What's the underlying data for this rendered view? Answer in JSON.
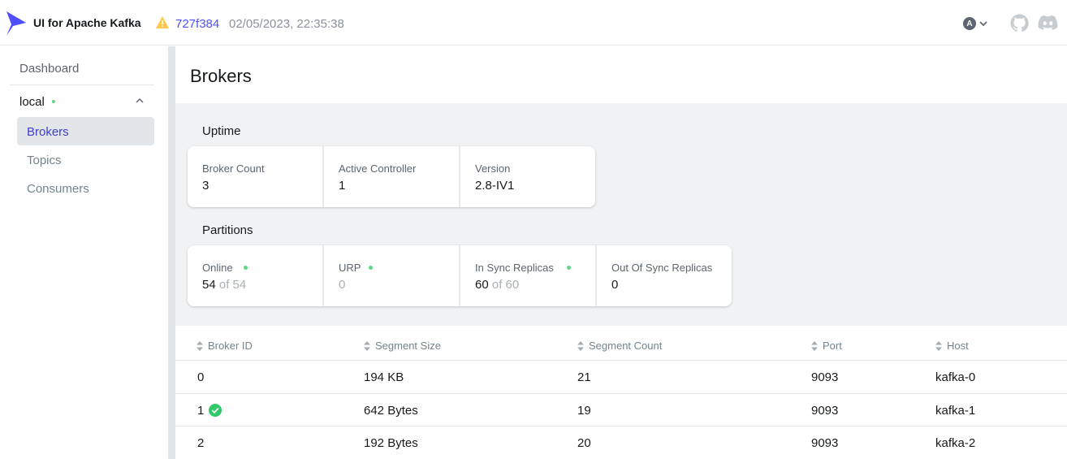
{
  "header": {
    "app_title": "UI for Apache Kafka",
    "version_commit": "727f384",
    "build_date": "02/05/2023, 22:35:38",
    "user_initial": "A",
    "brand_color": "#4f4fff"
  },
  "sidebar": {
    "dashboard": "Dashboard",
    "cluster_name": "local",
    "cluster_status": "online",
    "items": [
      {
        "label": "Brokers",
        "active": true
      },
      {
        "label": "Topics",
        "active": false
      },
      {
        "label": "Consumers",
        "active": false
      }
    ]
  },
  "main": {
    "title": "Brokers",
    "uptime": {
      "label": "Uptime",
      "cards": [
        {
          "label": "Broker Count",
          "value": "3"
        },
        {
          "label": "Active Controller",
          "value": "1"
        },
        {
          "label": "Version",
          "value": "2.8-IV1"
        }
      ]
    },
    "partitions": {
      "label": "Partitions",
      "cards": [
        {
          "label": "Online",
          "value": "54",
          "suffix": "of 54",
          "status": "ok"
        },
        {
          "label": "URP",
          "value": "0",
          "status": "ok"
        },
        {
          "label": "In Sync Replicas",
          "value": "60",
          "suffix": "of 60",
          "status": "ok"
        },
        {
          "label": "Out Of Sync Replicas",
          "value": "0"
        }
      ]
    },
    "table": {
      "columns": [
        "Broker ID",
        "Segment Size",
        "Segment Count",
        "Port",
        "Host"
      ],
      "rows": [
        {
          "broker_id": "0",
          "segment_size": "194 KB",
          "segment_count": "21",
          "port": "9093",
          "host": "kafka-0",
          "controller": false
        },
        {
          "broker_id": "1",
          "segment_size": "642 Bytes",
          "segment_count": "19",
          "port": "9093",
          "host": "kafka-1",
          "controller": true
        },
        {
          "broker_id": "2",
          "segment_size": "192 Bytes",
          "segment_count": "20",
          "port": "9093",
          "host": "kafka-2",
          "controller": false
        }
      ]
    }
  },
  "colors": {
    "status_ok": "#5cd685",
    "warning": "#ffc94d",
    "nav_active_text": "#3e3ecc"
  }
}
